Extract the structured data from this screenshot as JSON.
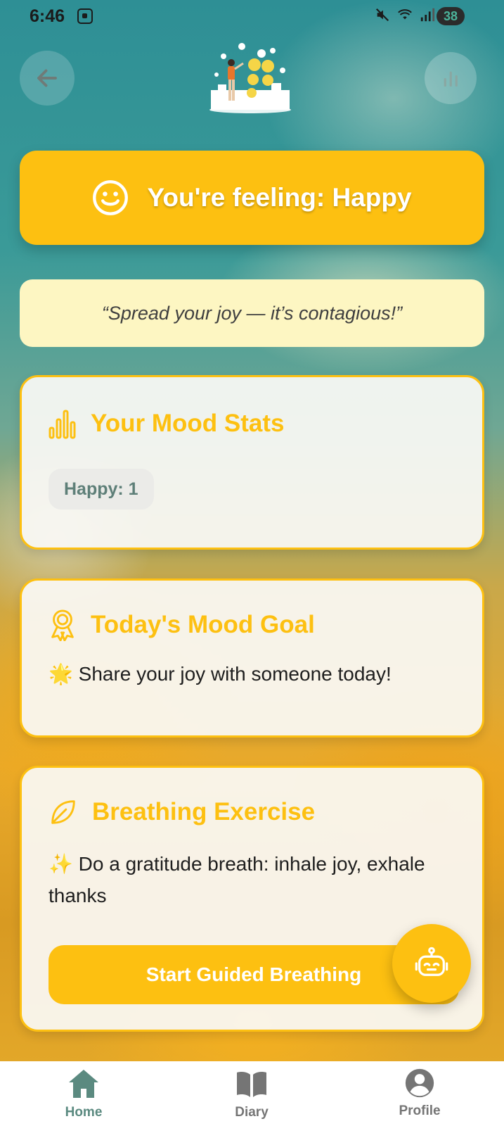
{
  "status_bar": {
    "time": "6:46",
    "battery": "38",
    "icons": [
      "screenshot-icon",
      "mute-icon",
      "wifi-icon",
      "signal-icon",
      "battery-icon"
    ]
  },
  "header": {
    "back_icon": "arrow-left-icon",
    "stats_icon": "bar-chart-icon",
    "logo": "mood-illustration-logo"
  },
  "feeling": {
    "icon": "smiley-face-icon",
    "text": "You're feeling: Happy"
  },
  "quote": {
    "text": "“Spread your joy — it’s contagious!”"
  },
  "mood_stats": {
    "icon": "bar-chart-icon",
    "title": "Your Mood Stats",
    "chips": [
      "Happy: 1"
    ]
  },
  "mood_goal": {
    "icon": "award-ribbon-icon",
    "title": "Today's Mood Goal",
    "text": "🌟 Share your joy with someone today!"
  },
  "breathing": {
    "icon": "leaf-icon",
    "title": "Breathing Exercise",
    "text": "✨ Do a gratitude breath: inhale joy, exhale thanks",
    "button_label": "Start Guided Breathing"
  },
  "fab": {
    "icon": "robot-icon"
  },
  "nav": {
    "items": [
      {
        "label": "Home",
        "icon": "home-icon",
        "active": true
      },
      {
        "label": "Diary",
        "icon": "book-icon",
        "active": false
      },
      {
        "label": "Profile",
        "icon": "profile-icon",
        "active": false
      }
    ]
  },
  "colors": {
    "accent": "#FDC011",
    "nav_active": "#5B8A80",
    "nav_inactive": "#757575",
    "quote_bg": "#FDF6C2"
  }
}
